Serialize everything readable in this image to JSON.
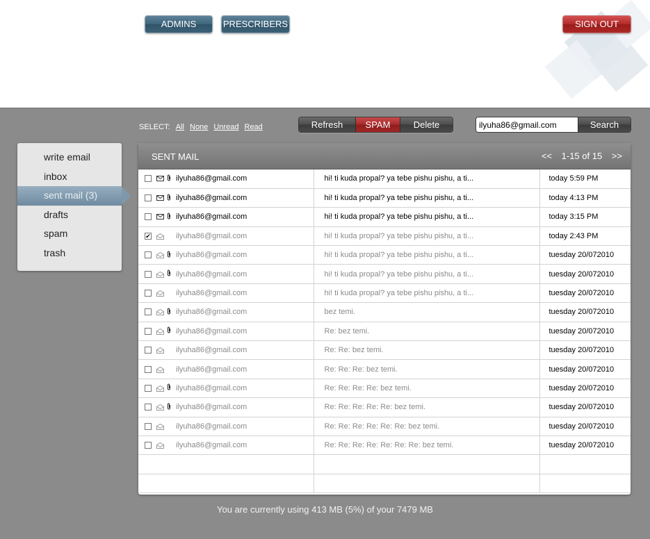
{
  "header": {
    "admins_label": "ADMINS",
    "prescribers_label": "PRESCRIBERS",
    "signout_label": "SIGN OUT"
  },
  "select": {
    "label": "SELECT:",
    "all": "All",
    "none": "None",
    "unread": "Unread",
    "read": "Read"
  },
  "actions": {
    "refresh": "Refresh",
    "spam": "SPAM",
    "delete": "Delete"
  },
  "search": {
    "value": "ilyuha86@gmail.com",
    "button": "Search"
  },
  "sidebar": {
    "items": [
      {
        "label": "write email"
      },
      {
        "label": "inbox"
      },
      {
        "label": "sent mail (3)"
      },
      {
        "label": "drafts"
      },
      {
        "label": "spam"
      },
      {
        "label": "trash"
      }
    ]
  },
  "panel": {
    "title": "SENT MAIL",
    "prev": "<<",
    "range": "1-15 of 15",
    "next": ">>"
  },
  "messages": [
    {
      "from": "ilyuha86@gmail.com",
      "subject": "hi! ti kuda propal? ya tebe pishu pishu, a ti...",
      "date": "today 5:59 PM",
      "unread": true,
      "checked": false,
      "attachment": true
    },
    {
      "from": "ilyuha86@gmail.com",
      "subject": "hi! ti kuda propal? ya tebe pishu pishu, a ti...",
      "date": "today 4:13 PM",
      "unread": true,
      "checked": false,
      "attachment": true
    },
    {
      "from": "ilyuha86@gmail.com",
      "subject": "hi! ti kuda propal? ya tebe pishu pishu, a ti...",
      "date": "today 3:15 PM",
      "unread": true,
      "checked": false,
      "attachment": true
    },
    {
      "from": "ilyuha86@gmail.com",
      "subject": "hi! ti kuda propal? ya tebe pishu pishu, a ti...",
      "date": "today 2:43 PM",
      "unread": false,
      "checked": true,
      "attachment": false
    },
    {
      "from": "ilyuha86@gmail.com",
      "subject": "hi! ti kuda propal? ya tebe pishu pishu, a ti...",
      "date": "tuesday 20/072010",
      "unread": false,
      "checked": false,
      "attachment": true
    },
    {
      "from": "ilyuha86@gmail.com",
      "subject": "hi! ti kuda propal? ya tebe pishu pishu, a ti...",
      "date": "tuesday 20/072010",
      "unread": false,
      "checked": false,
      "attachment": true
    },
    {
      "from": "ilyuha86@gmail.com",
      "subject": "hi! ti kuda propal? ya tebe pishu pishu, a ti...",
      "date": "tuesday 20/072010",
      "unread": false,
      "checked": false,
      "attachment": false
    },
    {
      "from": "ilyuha86@gmail.com",
      "subject": "bez temi.",
      "date": "tuesday 20/072010",
      "unread": false,
      "checked": false,
      "attachment": true
    },
    {
      "from": "ilyuha86@gmail.com",
      "subject": "Re: bez temi.",
      "date": "tuesday 20/072010",
      "unread": false,
      "checked": false,
      "attachment": true
    },
    {
      "from": "ilyuha86@gmail.com",
      "subject": "Re: Re: bez temi.",
      "date": "tuesday 20/072010",
      "unread": false,
      "checked": false,
      "attachment": false
    },
    {
      "from": "ilyuha86@gmail.com",
      "subject": "Re: Re: Re: bez temi.",
      "date": "tuesday 20/072010",
      "unread": false,
      "checked": false,
      "attachment": false
    },
    {
      "from": "ilyuha86@gmail.com",
      "subject": "Re: Re: Re: Re: bez temi.",
      "date": "tuesday 20/072010",
      "unread": false,
      "checked": false,
      "attachment": true
    },
    {
      "from": "ilyuha86@gmail.com",
      "subject": "Re: Re: Re: Re: Re: bez temi.",
      "date": "tuesday 20/072010",
      "unread": false,
      "checked": false,
      "attachment": true
    },
    {
      "from": "ilyuha86@gmail.com",
      "subject": "Re: Re: Re: Re: Re: Re: bez temi.",
      "date": "tuesday 20/072010",
      "unread": false,
      "checked": false,
      "attachment": false
    },
    {
      "from": "ilyuha86@gmail.com",
      "subject": "Re: Re: Re: Re: Re: Re: Re: bez temi.",
      "date": "tuesday 20/072010",
      "unread": false,
      "checked": false,
      "attachment": false
    }
  ],
  "icons": {
    "checkbox_checked": "✔",
    "attachment": "paperclip-icon",
    "envelope_unread": "envelope-closed-icon",
    "envelope_read": "envelope-open-icon"
  },
  "usage": "You are currently using 413 MB (5%) of your 7479 MB"
}
